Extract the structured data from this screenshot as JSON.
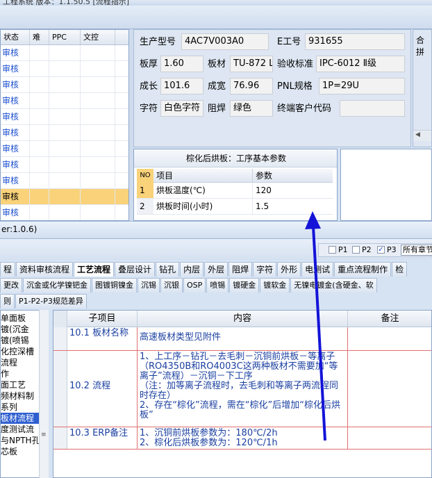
{
  "window": {
    "title": "工程系统  版本：1.1.50.5  [流程指示]"
  },
  "left_grid": {
    "headers": [
      "状态",
      "难",
      "PPC",
      "文控"
    ],
    "rows": [
      "审核",
      "审核",
      "审核",
      "审核",
      "审核",
      "审核",
      "审核",
      "审核",
      "审核",
      "审核",
      "审核"
    ],
    "selected_index": 9
  },
  "info": {
    "model_label": "生产型号",
    "model_value": "4AC7V003A0",
    "eno_label": "E工号",
    "eno_value": "931655",
    "thickness_label": "板厚",
    "thickness_value": "1.60",
    "material_label": "板材",
    "material_value": "TU-872 L",
    "standard_label": "验收标准",
    "standard_value": "IPC-6012 Ⅱ级",
    "length_label": "成长",
    "length_value": "101.6",
    "width_label": "成宽",
    "width_value": "76.96",
    "pnl_label": "PNL规格",
    "pnl_value": "1P=29U",
    "char_label": "字符",
    "char_value": "白色字符",
    "mask_label": "阻焊",
    "mask_value": "绿色",
    "customer_label": "终端客户代码",
    "customer_value": ""
  },
  "right_panel": {
    "title": "合拼"
  },
  "bake_panel": {
    "title": "棕化后烘板：工序基本参数",
    "headers": [
      "NO",
      "项目",
      "参数"
    ],
    "rows": [
      {
        "no": "1",
        "item": "烘板温度(℃)",
        "param": "120"
      },
      {
        "no": "2",
        "item": "烘板时间(小时)",
        "param": "1.5"
      }
    ]
  },
  "status": {
    "version": "er:1.0.6)"
  },
  "toolbar": {
    "p1": "P1",
    "p2": "P2",
    "p3": "P3",
    "p1_checked": false,
    "p2_checked": false,
    "p3_checked": true,
    "select_value": "所有章节"
  },
  "tabs_main": [
    "程",
    "资料审核流程",
    "工艺流程",
    "叠层设计",
    "钻孔",
    "内层",
    "外层",
    "阻焊",
    "字符",
    "外形",
    "电测试",
    "重点流程制作",
    "检"
  ],
  "tabs_main_active": 2,
  "tabs_sub": [
    "更改",
    "沉金或化学镍钯金",
    "图镀铜镍金",
    "沉锡",
    "沉银",
    "OSP",
    "喷锡",
    "镀硬金",
    "镀软金",
    "无镍电镀金(含硬金、软"
  ],
  "tabs_sub2": [
    "则",
    "P1-P2-P3规范差异"
  ],
  "left_list": {
    "items": [
      "单面板",
      "镀(沉金",
      "镀(喷锡",
      "化控深槽",
      "流程",
      "作",
      "面工艺",
      "频材料制",
      "系列",
      "板材流程",
      "度测试流",
      "与NPTH孔",
      "芯板"
    ],
    "selected_index": 9
  },
  "table": {
    "headers": [
      "子项目",
      "内容",
      "备注"
    ],
    "rows": [
      {
        "sub": "10.1 板材名称",
        "content": "高速板材类型见附件",
        "note": ""
      },
      {
        "sub": "10.2 流程",
        "content": "1、上工序－钻孔－去毛刺－沉铜前烘板－等离子（RO4350B和RO4003C这两种板材不需要加“等离子”流程）－沉铜－下工序\n（注：加等离子流程时，去毛刺和等离子两流程同时存在）\n2、存在“棕化”流程，需在“棕化”后增加“棕化后烘板”",
        "note": ""
      },
      {
        "sub": "10.3 ERP备注",
        "content": "1、沉铜前烘板参数为：180℃/2h\n2、棕化后烘板参数为：120℃/1h",
        "note": ""
      }
    ]
  },
  "colors": {
    "accent_blue": "#1414d8",
    "selected_orange": "#f9d27a",
    "link_blue": "#1a4fd0"
  }
}
